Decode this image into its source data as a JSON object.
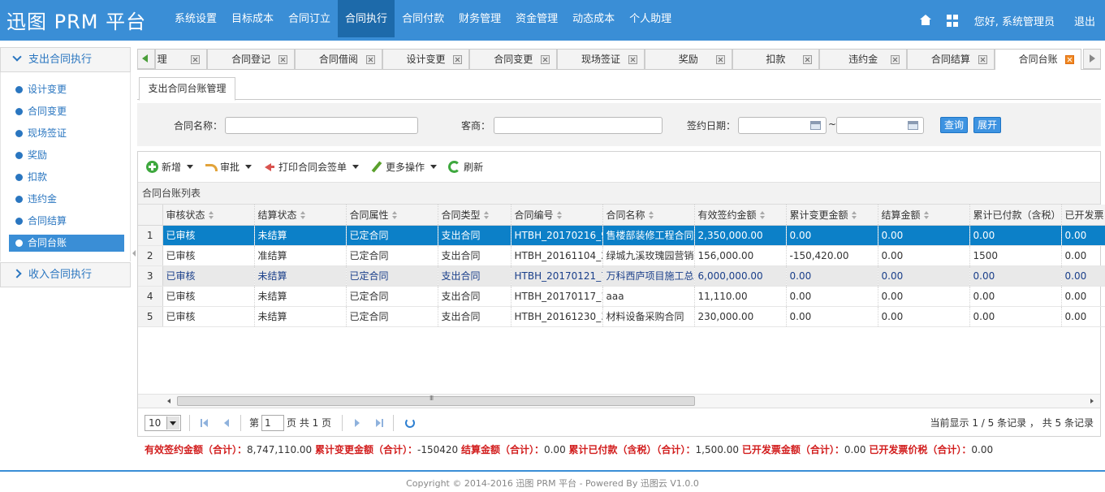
{
  "app": {
    "logo": "迅图 PRM 平台"
  },
  "nav": [
    {
      "label": "系统设置"
    },
    {
      "label": "目标成本"
    },
    {
      "label": "合同订立"
    },
    {
      "label": "合同执行",
      "active": true
    },
    {
      "label": "合同付款"
    },
    {
      "label": "财务管理"
    },
    {
      "label": "资金管理"
    },
    {
      "label": "动态成本"
    },
    {
      "label": "个人助理"
    }
  ],
  "user": {
    "welcome": "您好, 系统管理员",
    "logout": "退出"
  },
  "sidebar": {
    "group1": "支出合同执行",
    "items": [
      {
        "label": "设计变更"
      },
      {
        "label": "合同变更"
      },
      {
        "label": "现场签证"
      },
      {
        "label": "奖励"
      },
      {
        "label": "扣款"
      },
      {
        "label": "违约金"
      },
      {
        "label": "合同结算"
      },
      {
        "label": "合同台账",
        "active": true
      }
    ],
    "group2": "收入合同执行"
  },
  "tabs": [
    {
      "label": "理"
    },
    {
      "label": "合同登记"
    },
    {
      "label": "合同借阅"
    },
    {
      "label": "设计变更"
    },
    {
      "label": "合同变更"
    },
    {
      "label": "现场签证"
    },
    {
      "label": "奖励"
    },
    {
      "label": "扣款"
    },
    {
      "label": "违约金"
    },
    {
      "label": "合同结算"
    },
    {
      "label": "合同台账",
      "active": true
    }
  ],
  "subtab": "支出合同台账管理",
  "search": {
    "name_label": "合同名称：",
    "name_value": "",
    "vendor_label": "客商：",
    "vendor_value": "",
    "date_label": "签约日期：",
    "date_from": "",
    "date_to": "",
    "tilde": "~",
    "query_btn": "查询",
    "expand_btn": "展开"
  },
  "toolbar": {
    "add": "新增",
    "approve": "审批",
    "print": "打印合同会签单",
    "more": "更多操作",
    "refresh": "刷新"
  },
  "list_title": "合同台账列表",
  "table": {
    "headers": [
      "审核状态",
      "结算状态",
      "合同属性",
      "合同类型",
      "合同编号",
      "合同名称",
      "有效签约金额",
      "累计变更金额",
      "结算金额",
      "累计已付款（含税）",
      "已开发票"
    ],
    "rows": [
      {
        "no": "1",
        "cells": [
          "已审核",
          "未结算",
          "已定合同",
          "支出合同",
          "HTBH_20170216_9",
          "售楼部装修工程合同",
          "2,350,000.00",
          "0.00",
          "0.00",
          "0.00",
          "0.00"
        ],
        "state": "selected"
      },
      {
        "no": "2",
        "cells": [
          "已审核",
          "准结算",
          "已定合同",
          "支出合同",
          "HTBH_20161104_2",
          "绿城九溪玫瑰园营销",
          "156,000.00",
          "-150,420.00",
          "0.00",
          "1500",
          "0.00"
        ],
        "state": ""
      },
      {
        "no": "3",
        "cells": [
          "已审核",
          "未结算",
          "已定合同",
          "支出合同",
          "HTBH_20170121_7",
          "万科西庐项目施工总",
          "6,000,000.00",
          "0.00",
          "0.00",
          "0.00",
          "0.00"
        ],
        "state": "alt"
      },
      {
        "no": "4",
        "cells": [
          "已审核",
          "未结算",
          "已定合同",
          "支出合同",
          "HTBH_20170117_1",
          "aaa",
          "11,110.00",
          "0.00",
          "0.00",
          "0.00",
          "0.00"
        ],
        "state": ""
      },
      {
        "no": "5",
        "cells": [
          "已审核",
          "未结算",
          "已定合同",
          "支出合同",
          "HTBH_20161230_3",
          "材料设备采购合同",
          "230,000.00",
          "0.00",
          "0.00",
          "0.00",
          "0.00"
        ],
        "state": ""
      }
    ]
  },
  "pager": {
    "page_size": "10",
    "page_prefix": "第",
    "page_value": "1",
    "page_suffix": "页 共 1 页",
    "info": "当前显示 1 / 5 条记录 ， 共 5 条记录"
  },
  "summary": [
    {
      "k": "有效签约金额（合计）：",
      "v": "8,747,110.00 "
    },
    {
      "k": "累计变更金额（合计）：",
      "v": "-150420 "
    },
    {
      "k": "结算金额（合计）：",
      "v": "0.00 "
    },
    {
      "k": "累计已付款（含税）（合计）：",
      "v": "1,500.00 "
    },
    {
      "k": "已开发票金额（合计）：",
      "v": "0.00 "
    },
    {
      "k": "已开发票价税（合计）：",
      "v": "0.00"
    }
  ],
  "footer": "Copyright © 2014-2016 迅图 PRM 平台 - Powered By 迅图云 V1.0.0"
}
